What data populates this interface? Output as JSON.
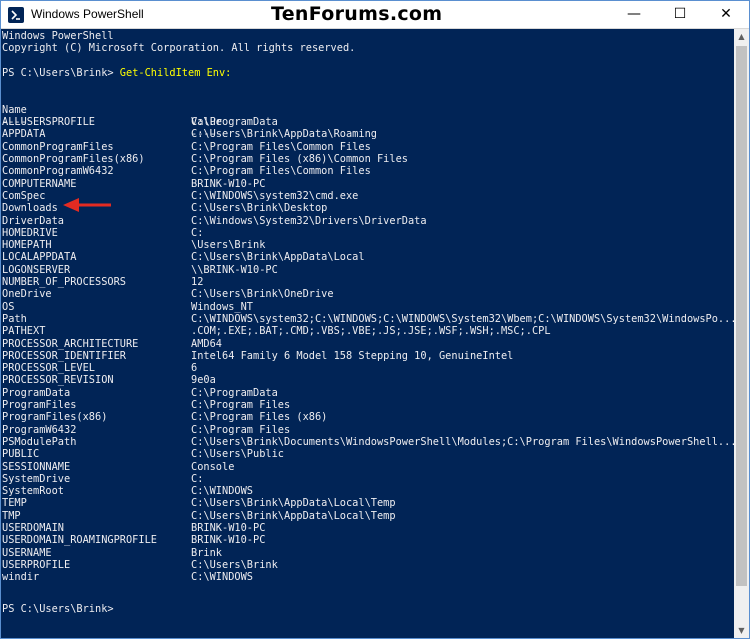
{
  "window": {
    "title": "Windows PowerShell",
    "watermark": "TenForums.com",
    "minimize_glyph": "—",
    "maximize_glyph": "☐",
    "close_glyph": "✕",
    "icon": "powershell-icon"
  },
  "console": {
    "header_lines": [
      "Windows PowerShell",
      "Copyright (C) Microsoft Corporation. All rights reserved."
    ],
    "prompt": "PS C:\\Users\\Brink> ",
    "command": "Get-ChildItem Env:",
    "columns": {
      "name_header": "Name",
      "value_header": "Value",
      "name_rule": "----",
      "value_rule": "-----"
    },
    "rows": [
      {
        "name": "ALLUSERSPROFILE",
        "value": "C:\\ProgramData"
      },
      {
        "name": "APPDATA",
        "value": "C:\\Users\\Brink\\AppData\\Roaming"
      },
      {
        "name": "CommonProgramFiles",
        "value": "C:\\Program Files\\Common Files"
      },
      {
        "name": "CommonProgramFiles(x86)",
        "value": "C:\\Program Files (x86)\\Common Files"
      },
      {
        "name": "CommonProgramW6432",
        "value": "C:\\Program Files\\Common Files"
      },
      {
        "name": "COMPUTERNAME",
        "value": "BRINK-W10-PC"
      },
      {
        "name": "ComSpec",
        "value": "C:\\WINDOWS\\system32\\cmd.exe"
      },
      {
        "name": "Downloads",
        "value": "C:\\Users\\Brink\\Desktop"
      },
      {
        "name": "DriverData",
        "value": "C:\\Windows\\System32\\Drivers\\DriverData"
      },
      {
        "name": "HOMEDRIVE",
        "value": "C:"
      },
      {
        "name": "HOMEPATH",
        "value": "\\Users\\Brink"
      },
      {
        "name": "LOCALAPPDATA",
        "value": "C:\\Users\\Brink\\AppData\\Local"
      },
      {
        "name": "LOGONSERVER",
        "value": "\\\\BRINK-W10-PC"
      },
      {
        "name": "NUMBER_OF_PROCESSORS",
        "value": "12"
      },
      {
        "name": "OneDrive",
        "value": "C:\\Users\\Brink\\OneDrive"
      },
      {
        "name": "OS",
        "value": "Windows_NT"
      },
      {
        "name": "Path",
        "value": "C:\\WINDOWS\\system32;C:\\WINDOWS;C:\\WINDOWS\\System32\\Wbem;C:\\WINDOWS\\System32\\WindowsPo..."
      },
      {
        "name": "PATHEXT",
        "value": ".COM;.EXE;.BAT;.CMD;.VBS;.VBE;.JS;.JSE;.WSF;.WSH;.MSC;.CPL"
      },
      {
        "name": "PROCESSOR_ARCHITECTURE",
        "value": "AMD64"
      },
      {
        "name": "PROCESSOR_IDENTIFIER",
        "value": "Intel64 Family 6 Model 158 Stepping 10, GenuineIntel"
      },
      {
        "name": "PROCESSOR_LEVEL",
        "value": "6"
      },
      {
        "name": "PROCESSOR_REVISION",
        "value": "9e0a"
      },
      {
        "name": "ProgramData",
        "value": "C:\\ProgramData"
      },
      {
        "name": "ProgramFiles",
        "value": "C:\\Program Files"
      },
      {
        "name": "ProgramFiles(x86)",
        "value": "C:\\Program Files (x86)"
      },
      {
        "name": "ProgramW6432",
        "value": "C:\\Program Files"
      },
      {
        "name": "PSModulePath",
        "value": "C:\\Users\\Brink\\Documents\\WindowsPowerShell\\Modules;C:\\Program Files\\WindowsPowerShell..."
      },
      {
        "name": "PUBLIC",
        "value": "C:\\Users\\Public"
      },
      {
        "name": "SESSIONNAME",
        "value": "Console"
      },
      {
        "name": "SystemDrive",
        "value": "C:"
      },
      {
        "name": "SystemRoot",
        "value": "C:\\WINDOWS"
      },
      {
        "name": "TEMP",
        "value": "C:\\Users\\Brink\\AppData\\Local\\Temp"
      },
      {
        "name": "TMP",
        "value": "C:\\Users\\Brink\\AppData\\Local\\Temp"
      },
      {
        "name": "USERDOMAIN",
        "value": "BRINK-W10-PC"
      },
      {
        "name": "USERDOMAIN_ROAMINGPROFILE",
        "value": "BRINK-W10-PC"
      },
      {
        "name": "USERNAME",
        "value": "Brink"
      },
      {
        "name": "USERPROFILE",
        "value": "C:\\Users\\Brink"
      },
      {
        "name": "windir",
        "value": "C:\\WINDOWS"
      }
    ],
    "final_prompt": "PS C:\\Users\\Brink>"
  },
  "colors": {
    "console_bg": "#012456",
    "text": "#eeedf0",
    "command": "#ffff00",
    "annotation_arrow": "#e32b22"
  },
  "annotation": {
    "icon": "red-arrow-icon",
    "points_to_row": "Downloads"
  }
}
